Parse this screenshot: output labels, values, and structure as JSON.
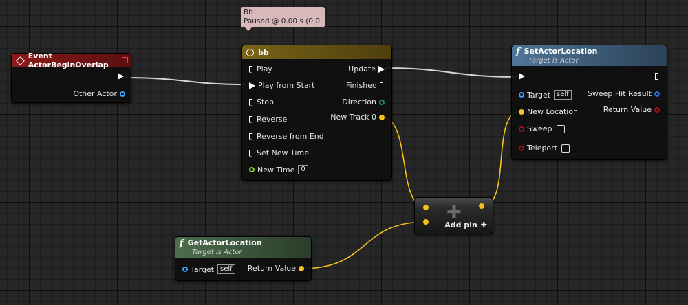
{
  "colors": {
    "graph_bg": "#262626",
    "event_header": "#8c1a1a",
    "timeline_header": "#6b5a17",
    "function_header": "#4a6a8a",
    "pure_header": "#3d5a3d",
    "exec_wire": "#ffffff",
    "vector_pin": "#f5c21a",
    "object_pin": "#3aa0ff",
    "struct_pin": "#2a6b6b",
    "bool_pin": "#8b0000",
    "float_pin": "#7ccf3a"
  },
  "debug_bubble": {
    "title": "Bb",
    "status": "Paused @ 0.00 s (0.0 %)"
  },
  "event_node": {
    "title": "Event ActorBeginOverlap",
    "icon": "event-diamond-icon",
    "out_pin": "Other Actor"
  },
  "timeline_node": {
    "title": "bb",
    "icon": "clock-icon",
    "inputs": [
      "Play",
      "Play from Start",
      "Stop",
      "Reverse",
      "Reverse from End",
      "Set New Time"
    ],
    "new_time_label": "New Time",
    "new_time_value": "0",
    "outputs": [
      "Update",
      "Finished",
      "Direction",
      "New Track 0"
    ]
  },
  "set_location_node": {
    "title": "SetActorLocation",
    "subtitle": "Target is Actor",
    "icon": "function-icon",
    "target_label": "Target",
    "target_value": "self",
    "new_location_label": "New Location",
    "sweep_label": "Sweep",
    "teleport_label": "Teleport",
    "sweep_hit_result_label": "Sweep Hit Result",
    "return_value_label": "Return Value"
  },
  "add_node": {
    "add_pin_label": "Add pin",
    "plus": "✚"
  },
  "get_location_node": {
    "title": "GetActorLocation",
    "subtitle": "Target is Actor",
    "icon": "function-icon",
    "target_label": "Target",
    "target_value": "self",
    "return_value_label": "Return Value"
  }
}
